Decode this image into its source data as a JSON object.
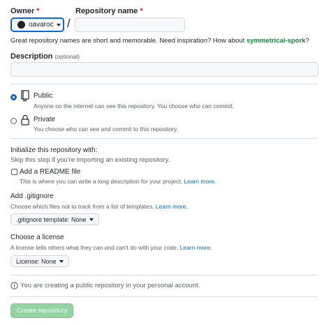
{
  "owner": {
    "label": "Owner",
    "required_mark": "*",
    "selected": "oavaroc"
  },
  "separator": "/",
  "repo_name": {
    "label": "Repository name",
    "required_mark": "*",
    "value": "",
    "placeholder": ""
  },
  "suggestion": {
    "text": "Great repository names are short and memorable. Need inspiration? How about",
    "name": "symmetrical-spork",
    "end": "?"
  },
  "description": {
    "label": "Description",
    "optional": "(optional)",
    "value": ""
  },
  "visibility": {
    "public": {
      "label": "Public",
      "desc": "Anyone on the internet can see this repository. You choose who can commit.",
      "checked": true
    },
    "private": {
      "label": "Private",
      "desc": "You choose who can see and commit to this repository.",
      "checked": false
    }
  },
  "init": {
    "heading": "Initialize this repository with:",
    "subtext": "Skip this step if you're importing an existing repository.",
    "readme": {
      "label": "Add a README file",
      "desc": "This is where you can write a long description for your project.",
      "link": "Learn more."
    }
  },
  "gitignore": {
    "heading": "Add .gitignore",
    "desc": "Choose which files not to track from a list of templates.",
    "link": "Learn more.",
    "button": ".gitignore template: None"
  },
  "license": {
    "heading": "Choose a license",
    "desc": "A license tells others what they can and can't do with your code.",
    "link": "Learn more.",
    "button": "License: None"
  },
  "notice": "You are creating a public repository in your personal account.",
  "submit": "Create repository",
  "colors": {
    "accent": "#0969da",
    "suggestion": "#1a7f37",
    "button_disabled": "#94d3a2"
  }
}
